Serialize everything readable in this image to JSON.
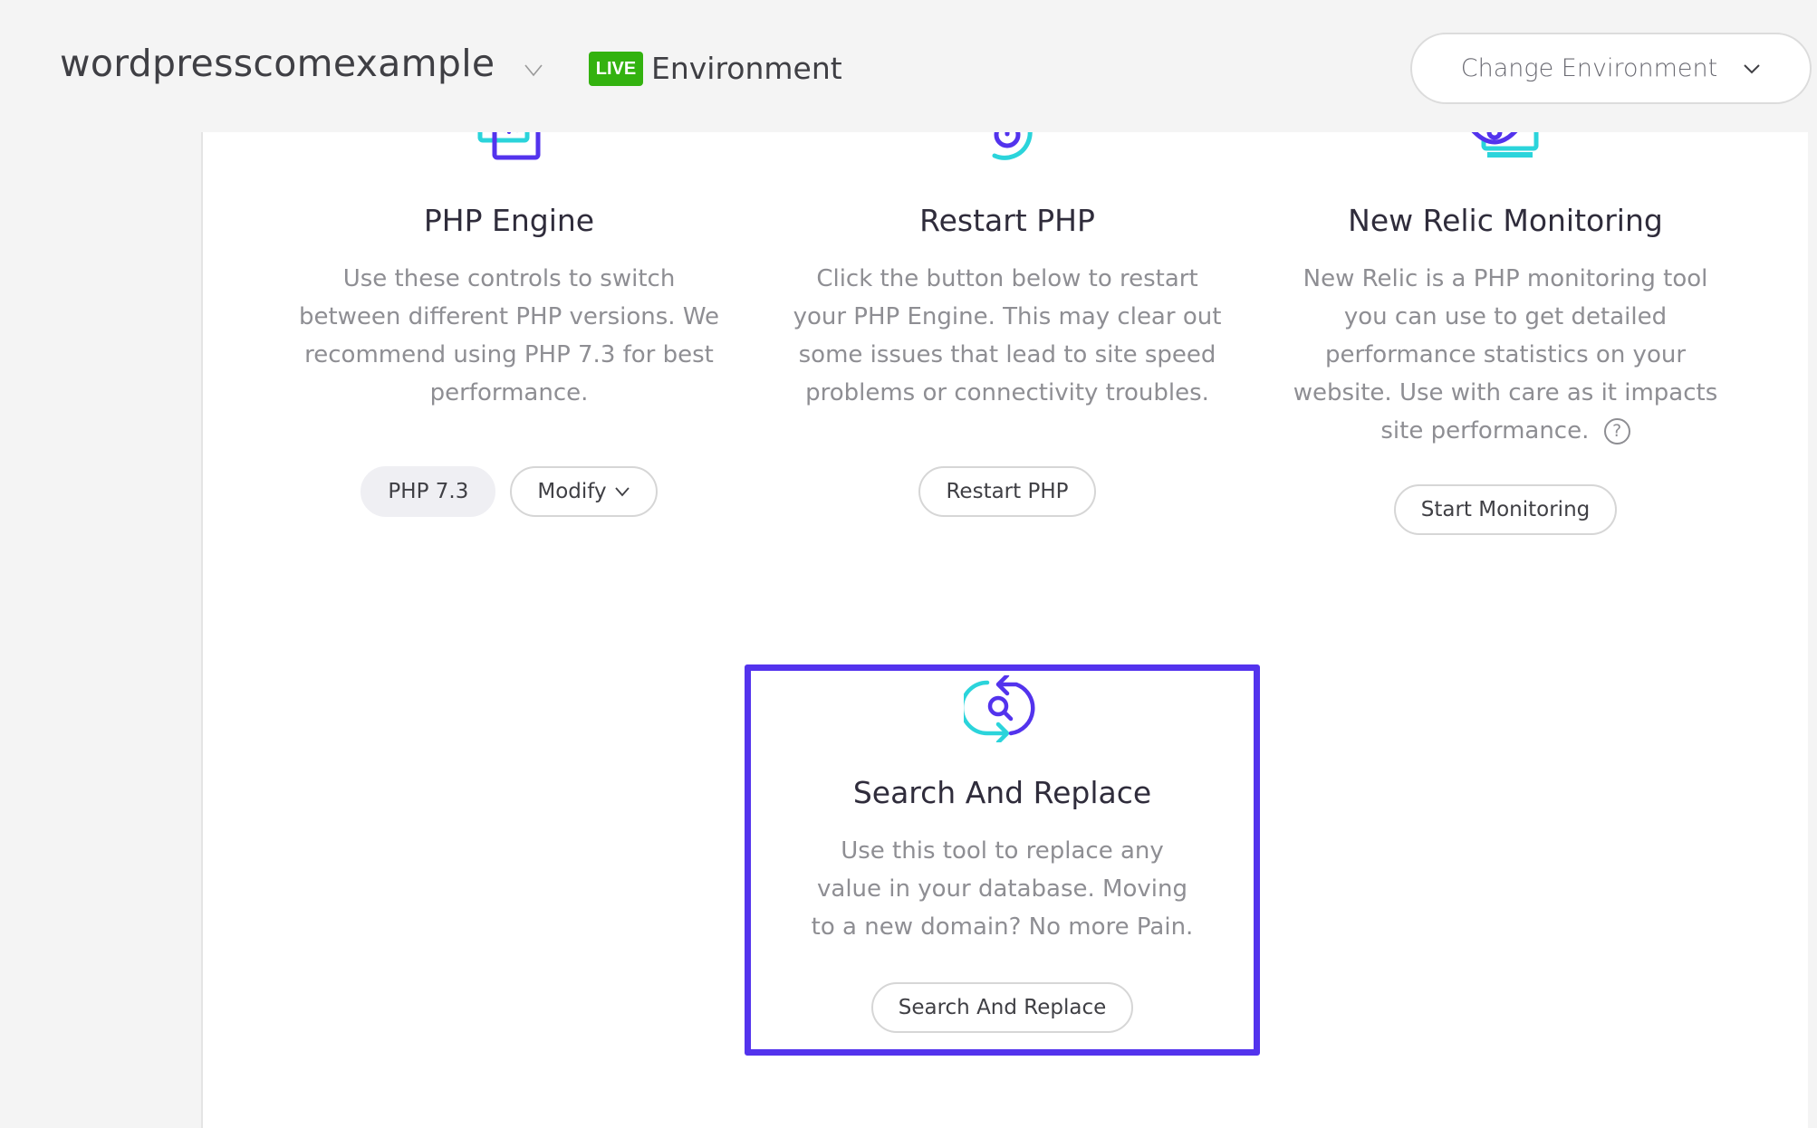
{
  "header": {
    "site_name": "wordpresscomexample",
    "environment_badge": "LIVE",
    "environment_label": "Environment",
    "change_environment_label": "Change Environment"
  },
  "colors": {
    "accent_purple": "#5333ed",
    "accent_teal": "#2bd4db",
    "live_green": "#33b20f"
  },
  "tools": [
    {
      "icon": "code-window-icon",
      "title": "PHP Engine",
      "description": "Use these controls to switch between different PHP versions. We recommend using PHP 7.3 for best performance.",
      "current_version": "PHP 7.3",
      "button_label": "Modify"
    },
    {
      "icon": "restart-power-icon",
      "title": "Restart PHP",
      "description": "Click the button below to restart your PHP Engine. This may clear out some issues that lead to site speed problems or connectivity troubles.",
      "button_label": "Restart PHP"
    },
    {
      "icon": "monitor-eye-icon",
      "title": "New Relic Monitoring",
      "description": "New Relic is a PHP monitoring tool you can use to get detailed performance statistics on your website. Use with care as it impacts site performance.",
      "help_glyph": "?",
      "button_label": "Start Monitoring"
    },
    {
      "icon": "search-replace-icon",
      "title": "Search And Replace",
      "description": "Use this tool to replace any value in your database. Moving to a new domain? No more Pain.",
      "button_label": "Search And Replace",
      "highlighted": true
    }
  ]
}
